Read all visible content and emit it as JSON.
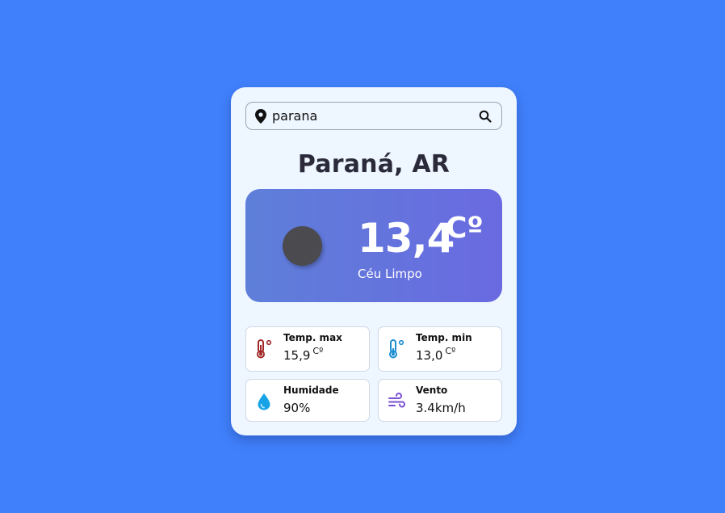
{
  "search": {
    "value": "parana",
    "placeholder": ""
  },
  "location": {
    "city": "Paraná, AR"
  },
  "current": {
    "temperature": "13,4",
    "unit": "Cº",
    "description": "Céu Limpo"
  },
  "details": {
    "temp_max": {
      "label": "Temp. max",
      "value": "15,9",
      "unit": "Cº"
    },
    "temp_min": {
      "label": "Temp. min",
      "value": "13,0",
      "unit": "Cº"
    },
    "humidity": {
      "label": "Humidade",
      "value": "90%"
    },
    "wind": {
      "label": "Vento",
      "value": "3.4km/h"
    }
  },
  "icons": {
    "search_bar_left": "location-pin-icon",
    "search_bar_right": "search-icon",
    "weather": "weather-icon",
    "temp_max": "thermometer-hot-icon",
    "temp_min": "thermometer-cold-icon",
    "humidity": "water-drop-icon",
    "wind": "wind-icon"
  },
  "colors": {
    "background": "#4080fb",
    "card": "#eef6ff",
    "hot": "#a12727",
    "cold": "#1c8fd1",
    "humidity": "#18a3e6",
    "wind": "#7a4fd6"
  }
}
